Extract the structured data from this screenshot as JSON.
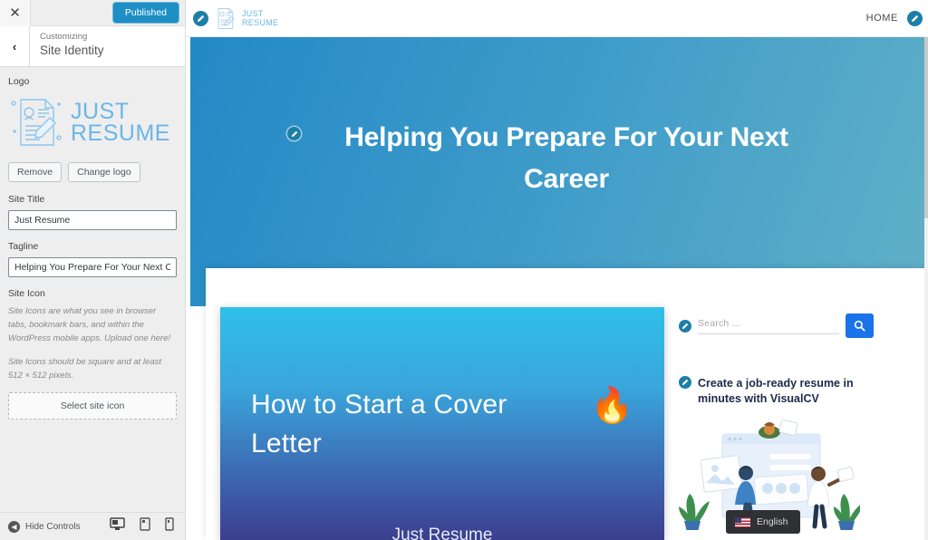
{
  "customizer": {
    "close_label": "✕",
    "publish_label": "Published",
    "back_label": "‹",
    "eyebrow": "Customizing",
    "section_title": "Site Identity",
    "logo": {
      "label": "Logo",
      "brand_line1": "JUST",
      "brand_line2": "RESUME",
      "remove_label": "Remove",
      "change_label": "Change logo"
    },
    "site_title": {
      "label": "Site Title",
      "value": "Just Resume"
    },
    "tagline": {
      "label": "Tagline",
      "value": "Helping You Prepare For Your Next Career"
    },
    "site_icon": {
      "label": "Site Icon",
      "description_1": "Site Icons are what you see in browser tabs, bookmark bars, and within the WordPress mobile apps. Upload one here!",
      "description_2": "Site Icons should be square and at least 512 × 512 pixels.",
      "select_label": "Select site icon"
    },
    "footer": {
      "hide_controls_label": "Hide Controls",
      "devices": [
        {
          "name": "desktop",
          "active": true
        },
        {
          "name": "tablet",
          "active": false
        },
        {
          "name": "mobile",
          "active": false
        }
      ]
    },
    "colors": {
      "publish_blue": "#1d8fc4",
      "panel_bg": "#eeeeee",
      "logo_blue": "#6cb6e8"
    }
  },
  "preview": {
    "header": {
      "brand_line1": "JUST",
      "brand_line2": "RESUME",
      "nav": [
        {
          "label": "HOME"
        }
      ]
    },
    "hero": {
      "title": "Helping You Prepare For Your Next Career",
      "gradient_from": "#2389c6",
      "gradient_to": "#61b0c8"
    },
    "post_card": {
      "title": "How to Start a Cover Letter",
      "emoji": "🔥",
      "footer_text": "Just Resume",
      "gradient_from": "#2ec0e8",
      "gradient_to": "#3b3f8f"
    },
    "sidebar": {
      "search": {
        "placeholder": "Search ...",
        "value": "",
        "button_icon": "search-icon",
        "button_color": "#1a73e8"
      },
      "promo": {
        "title": "Create a job-ready resume in minutes with VisualCV"
      },
      "language": {
        "label": "English",
        "flag": "us-flag"
      }
    }
  }
}
